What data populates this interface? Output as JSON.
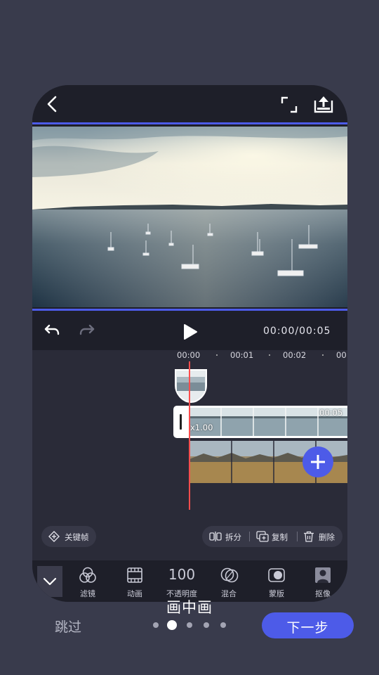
{
  "app": {
    "back_icon": "chevron-left-icon",
    "fullscreen_icon": "fullscreen-icon",
    "export_icon": "export-icon"
  },
  "player": {
    "undo_icon": "undo-icon",
    "redo_icon": "redo-icon",
    "play_icon": "play-icon",
    "time_display": "00:00/00:05"
  },
  "timeline": {
    "ruler": [
      "00:00",
      "00:01",
      "00:02",
      "00"
    ],
    "main_clip_speed": "x1.00",
    "main_clip_duration": "00:05",
    "keyframe_label": "关键帧",
    "actions": [
      {
        "label": "拆分",
        "icon": "split-icon"
      },
      {
        "label": "复制",
        "icon": "copy-icon"
      },
      {
        "label": "删除",
        "icon": "trash-icon"
      }
    ]
  },
  "toolbar": {
    "collapse_icon": "chevron-down-icon",
    "items": [
      {
        "label": "滤镜",
        "icon": "filter-icon"
      },
      {
        "label": "动画",
        "icon": "film-icon"
      },
      {
        "label": "不透明度",
        "value": "100"
      },
      {
        "label": "混合",
        "icon": "blend-icon"
      },
      {
        "label": "蒙版",
        "icon": "mask-icon"
      },
      {
        "label": "抠像",
        "icon": "portrait-icon"
      }
    ]
  },
  "onboarding": {
    "feature_title": "画中画",
    "skip_label": "跳过",
    "next_label": "下一步",
    "page_count": 5,
    "active_page": 2
  },
  "colors": {
    "accent": "#4d5be8",
    "playhead": "#ff4d4d",
    "background": "#393b4c"
  }
}
